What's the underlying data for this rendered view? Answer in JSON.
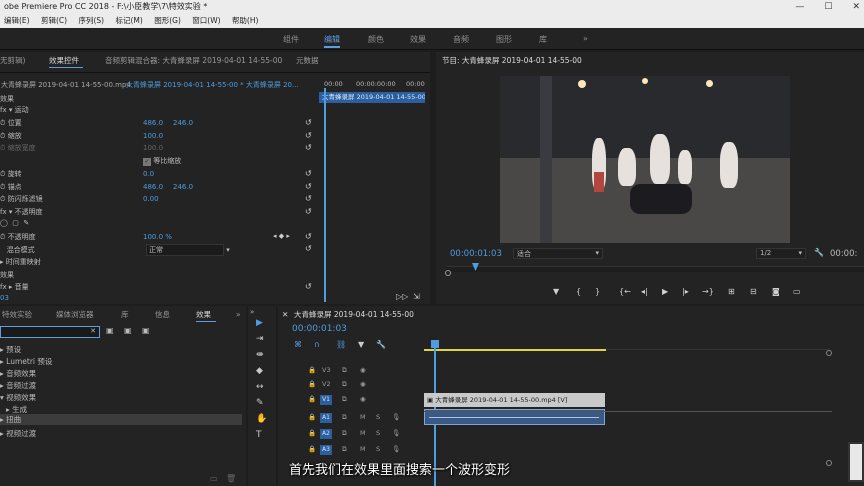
{
  "window": {
    "title": "obe Premiere Pro CC 2018 - F:\\小臣教学\\7\\特效实验 *"
  },
  "menu": [
    "编辑(E)",
    "剪辑(C)",
    "序列(S)",
    "标记(M)",
    "图形(G)",
    "窗口(W)",
    "帮助(H)"
  ],
  "workspaces": [
    "组件",
    "编辑",
    "颜色",
    "效果",
    "音频",
    "图形",
    "库",
    "»"
  ],
  "active_workspace": "编辑",
  "effect_controls": {
    "tabs": [
      "无剪辑)",
      "效果控件",
      "音频剪辑混合器: 大青蜂录屏 2019-04-01 14-55-00",
      "元数据"
    ],
    "source_clip": "大青蜂录屏 2019-04-01 14-55-00.mp4",
    "sequence_clip": "大青蜂录屏 2019-04-01 14-55-00 * 大青蜂录屏 20...",
    "ruler_start": "00:00",
    "ruler_mid": "00:00:00:00",
    "ruler_end": "00:00",
    "clip_bar": "大青蜂录屏 2019-04-01 14-55-00",
    "section_video": "效果",
    "rows": [
      {
        "label": "运动",
        "v1": "",
        "v2": ""
      },
      {
        "label": "位置",
        "v1": "486.0",
        "v2": "246.0"
      },
      {
        "label": "缩放",
        "v1": "100.0",
        "v2": ""
      },
      {
        "label": "缩放宽度",
        "v1": "100.0",
        "v2": ""
      },
      {
        "label": "等比缩放",
        "v1": "",
        "v2": ""
      },
      {
        "label": "旋转",
        "v1": "0.0",
        "v2": ""
      },
      {
        "label": "锚点",
        "v1": "486.0",
        "v2": "246.0"
      },
      {
        "label": "防闪烁滤镜",
        "v1": "0.00",
        "v2": ""
      },
      {
        "label": "不透明度",
        "v1": "",
        "v2": ""
      },
      {
        "label": "不透明度",
        "v1": "100.0 %",
        "v2": ""
      },
      {
        "label": "混合模式",
        "v1": "正常",
        "v2": ""
      },
      {
        "label": "时间重映射",
        "v1": "",
        "v2": ""
      },
      {
        "label": "效果",
        "v1": "",
        "v2": ""
      },
      {
        "label": "音量",
        "v1": "",
        "v2": ""
      }
    ],
    "timecode": "03"
  },
  "program": {
    "tab": "节目: 大青蜂录屏 2019-04-01 14-55-00",
    "timecode": "00:00:01:03",
    "fit": "适合",
    "resolution": "1/2",
    "duration": "00:00:"
  },
  "effects_panel": {
    "tabs": [
      "特效实验",
      "媒体浏览器",
      "库",
      "信息",
      "效果",
      "»"
    ],
    "search_value": "",
    "items": [
      "预设",
      "Lumetri 预设",
      "音频效果",
      "音频过渡",
      "视频效果",
      "生成",
      "扭曲",
      "视频过渡"
    ],
    "highlight": "扭曲"
  },
  "timeline": {
    "tab": "大青蜂录屏 2019-04-01 14-55-00",
    "timecode": "00:00:01:03",
    "tracks": [
      "V3",
      "V2",
      "V1",
      "A1",
      "A2",
      "A3"
    ],
    "clip_label": "大青蜂录屏 2019-04-01 14-55-00.mp4 [V]"
  },
  "subtitle": "首先我们在效果里面搜索一个波形变形"
}
